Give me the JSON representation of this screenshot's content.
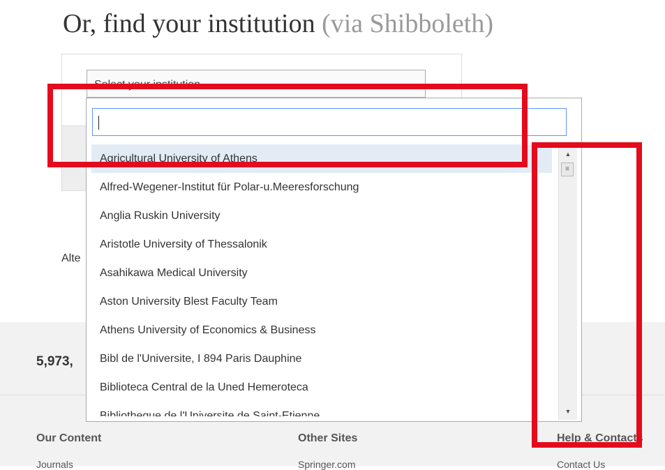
{
  "heading": {
    "main": "Or, find your institution",
    "sub": "(via Shibboleth)"
  },
  "select": {
    "placeholder": "Select your institution"
  },
  "alternate_text": "Alte",
  "dropdown": {
    "search_value": "",
    "options": [
      "Agricultural University of Athens",
      "Alfred-Wegener-Institut für Polar-u.Meeresforschung",
      "Anglia Ruskin University",
      "Aristotle University of Thessalonik",
      "Asahikawa Medical University",
      "Aston University Blest Faculty Team",
      "Athens University of Economics & Business",
      "Bibl de l'Universite, I 894 Paris Dauphine",
      "Biblioteca Central de la Uned Hemeroteca",
      "Bibliotheque de l'Universite de Saint-Etienne"
    ],
    "highlighted_index": 0
  },
  "footer": {
    "stat": "5,973,",
    "columns": [
      {
        "title": "Our Content",
        "link": "Journals"
      },
      {
        "title": "Other Sites",
        "link": "Springer.com"
      },
      {
        "title": "Help & Contacts",
        "link": "Contact Us"
      }
    ]
  },
  "icons": {
    "scroll_up": "triangle-up",
    "scroll_down": "triangle-down",
    "scroll_thumb": "grip-lines"
  },
  "colors": {
    "annotation": "#e30b1c",
    "focus_border": "#5897fb",
    "highlight": "#e3ecf5"
  }
}
